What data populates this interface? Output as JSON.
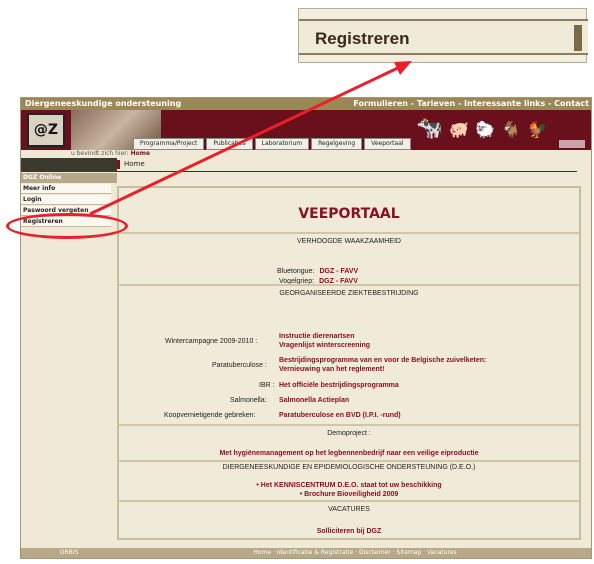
{
  "callout": {
    "label": "Registreren"
  },
  "site": {
    "topbar": {
      "left": "Diergeneeskundige ondersteuning",
      "right": "Formulieren - Tarieven - Interessante links - Contact"
    },
    "logo": "@Z",
    "tabs": [
      "Programma/Project",
      "Publicaties",
      "Laboratorium",
      "Regelgeving",
      "Veeportaal"
    ],
    "breadcrumb_prefix": "u bevindt zich hier:",
    "breadcrumb_current": "Home",
    "home_label": "Home",
    "sidebar": {
      "title": "DGZ Online",
      "items": [
        "Meer info",
        "Login",
        "Paswoord vergeten",
        "Registreren"
      ]
    },
    "footer_left": "ORBIS",
    "footer": "Home · Identificatie & Registratie · Disclaimer · Sitemap · Vacatures"
  },
  "main": {
    "title": "VEEPORTAAL",
    "verhoogde": {
      "heading": "VERHOOGDE WAAKZAAMHEID",
      "bluetongue_label": "Bluetongue:",
      "bluetongue_link": "DGZ - FAVV",
      "vogelgriep_label": "Vogelgriep:",
      "vogelgriep_link": "DGZ - FAVV"
    },
    "georganiseerde": {
      "heading": "GEORGANISEERDE ZIEKTEBESTRIJDING",
      "rows": [
        {
          "label": "Wintercampagne 2009-2010 :",
          "links": [
            "Instructie dierenartsen",
            "Vragenlijst winterscreening"
          ]
        },
        {
          "label": "Paratuberculose :",
          "links": [
            "Bestrijdingsprogramma van en voor de Belgische zuivelketen:",
            "Vernieuwing van het reglement!"
          ]
        },
        {
          "label": "IBR :",
          "links": [
            "Het officiële bestrijdingsprogramma"
          ]
        },
        {
          "label": "Salmonella:",
          "links": [
            "Salmonella Actieplan"
          ]
        },
        {
          "label": "Koopvernietigende gebreken:",
          "links": [
            "Paratuberculose en BVD (I.P.I. -rund)"
          ]
        }
      ]
    },
    "demo": {
      "heading": "Demoproject :",
      "link": "Met hygiënemanagement op het legbennenbedrijf naar een veilige eiproductie"
    },
    "deo": {
      "heading": "DIERGENEESKUNDIGE EN EPIDEMIOLOGISCHE ONDERSTEUNING (D.E.O.)",
      "links": [
        "Het KENNISCENTRUM D.E.O. staat tot uw beschikking",
        "Brochure Bioveiligheid 2009"
      ]
    },
    "vacatures": {
      "heading": "VACATURES",
      "link": "Solliciteren bij DGZ"
    }
  },
  "colors": {
    "annotation": "#e8202a",
    "brand": "#8b1023",
    "banner": "#6a0f1c"
  }
}
